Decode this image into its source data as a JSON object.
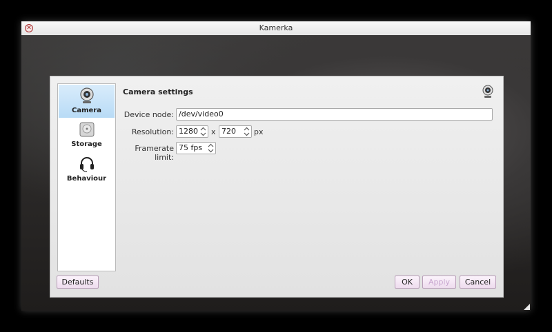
{
  "window": {
    "title": "Kamerka"
  },
  "sidebar": {
    "items": [
      {
        "label": "Camera",
        "icon": "webcam-icon",
        "selected": true
      },
      {
        "label": "Storage",
        "icon": "hard-drive-icon",
        "selected": false
      },
      {
        "label": "Behaviour",
        "icon": "headset-icon",
        "selected": false
      }
    ]
  },
  "settings": {
    "section_title": "Camera settings",
    "section_icon": "webcam-icon",
    "device_node": {
      "label": "Device node:",
      "value": "/dev/video0"
    },
    "resolution": {
      "label": "Resolution:",
      "width": "1280",
      "separator": "x",
      "height": "720",
      "unit": "px"
    },
    "framerate": {
      "label": "Framerate limit:",
      "value": "75 fps"
    }
  },
  "buttons": {
    "defaults": "Defaults",
    "ok": "OK",
    "apply": "Apply",
    "cancel": "Cancel"
  },
  "colors": {
    "selection": "#b8dbf6",
    "button_tint": "#eedcee",
    "disabled_text": "#c8a6cf"
  }
}
